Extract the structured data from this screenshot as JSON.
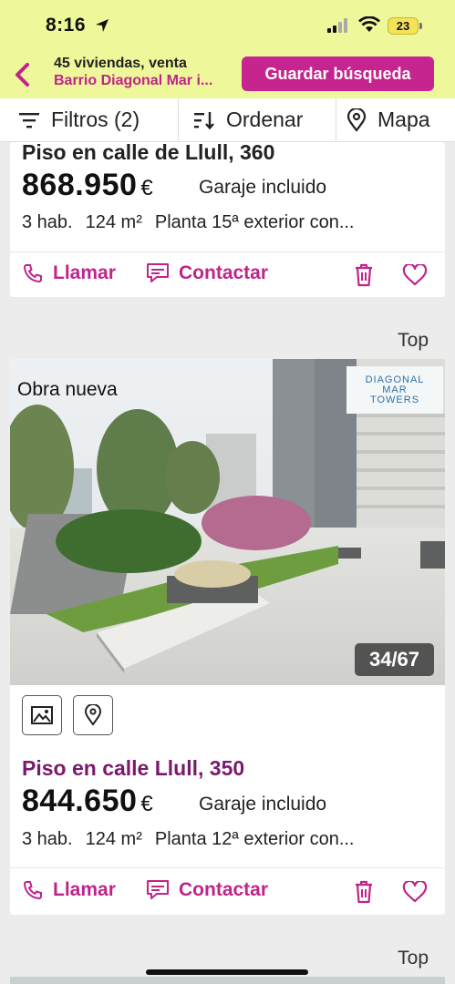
{
  "status": {
    "time": "8:16",
    "battery": "23"
  },
  "header": {
    "title": "45 viviendas, venta",
    "subtitle": "Barrio Diagonal Mar i...",
    "save_label": "Guardar búsqueda"
  },
  "toolbar": {
    "filters": "Filtros (2)",
    "sort": "Ordenar",
    "map": "Mapa"
  },
  "listings": [
    {
      "title": "Piso en calle de Llull, 360",
      "price": "868.950",
      "currency": "€",
      "parking": "Garaje incluido",
      "rooms": "3 hab.",
      "size": "124 m²",
      "floor": "Planta 15ª exterior con...",
      "call_label": "Llamar",
      "contact_label": "Contactar"
    },
    {
      "top_label": "Top",
      "badge": "Obra nueva",
      "logo": [
        "DIAGONAL",
        "MAR",
        "TOWERS"
      ],
      "photo_counter": "34/67",
      "title": "Piso en calle Llull, 350",
      "price": "844.650",
      "currency": "€",
      "parking": "Garaje incluido",
      "rooms": "3 hab.",
      "size": "124 m²",
      "floor": "Planta 12ª exterior con...",
      "call_label": "Llamar",
      "contact_label": "Contactar"
    }
  ],
  "next_top_label": "Top",
  "colors": {
    "accent": "#c6248f",
    "header_bg": "#eef79a",
    "title_purple": "#7a1a6a"
  }
}
